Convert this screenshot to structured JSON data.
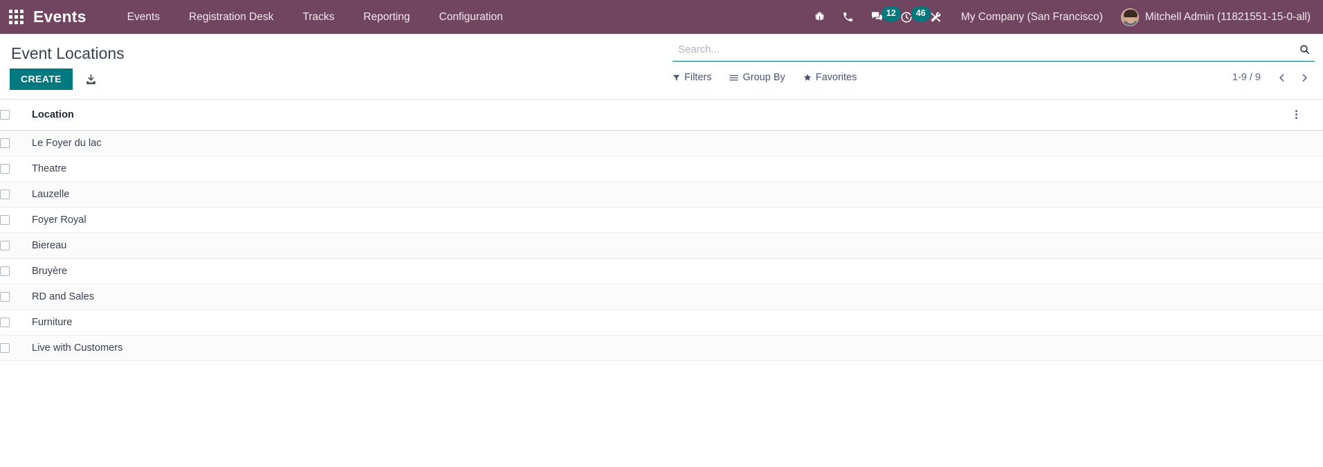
{
  "navbar": {
    "apps_icon": "apps-grid-icon",
    "brand": "Events",
    "menu_items": [
      {
        "label": "Events"
      },
      {
        "label": "Registration Desk"
      },
      {
        "label": "Tracks"
      },
      {
        "label": "Reporting"
      },
      {
        "label": "Configuration"
      }
    ],
    "sys_icons": [
      {
        "name": "bug-icon",
        "badge": null
      },
      {
        "name": "phone-icon",
        "badge": null
      },
      {
        "name": "messages-icon",
        "badge": "12"
      },
      {
        "name": "activities-clock-icon",
        "badge": "46"
      },
      {
        "name": "tools-icon",
        "badge": null
      }
    ],
    "company": "My Company (San Francisco)",
    "user_name": "Mitchell Admin (11821551-15-0-all)",
    "avatar": "user-avatar",
    "bg_color": "#71445f"
  },
  "control_panel": {
    "page_title": "Event Locations",
    "create_label": "CREATE",
    "import_icon": "import-download-icon",
    "accent_color": "#00787f"
  },
  "search": {
    "placeholder": "Search...",
    "value": "",
    "search_icon": "search-icon"
  },
  "filters": {
    "filters_label": "Filters",
    "group_by_label": "Group By",
    "favorites_label": "Favorites"
  },
  "pager": {
    "range": "1-9 / 9",
    "prev_icon": "chevron-left-icon",
    "next_icon": "chevron-right-icon"
  },
  "table": {
    "columns": [
      "Location"
    ],
    "options_icon": "options-dots-icon",
    "rows": [
      {
        "location": "Le Foyer du lac"
      },
      {
        "location": "Theatre"
      },
      {
        "location": "Lauzelle"
      },
      {
        "location": "Foyer Royal"
      },
      {
        "location": "Biereau"
      },
      {
        "location": "Bruyère"
      },
      {
        "location": "RD and Sales"
      },
      {
        "location": "Furniture"
      },
      {
        "location": "Live with Customers"
      }
    ]
  }
}
